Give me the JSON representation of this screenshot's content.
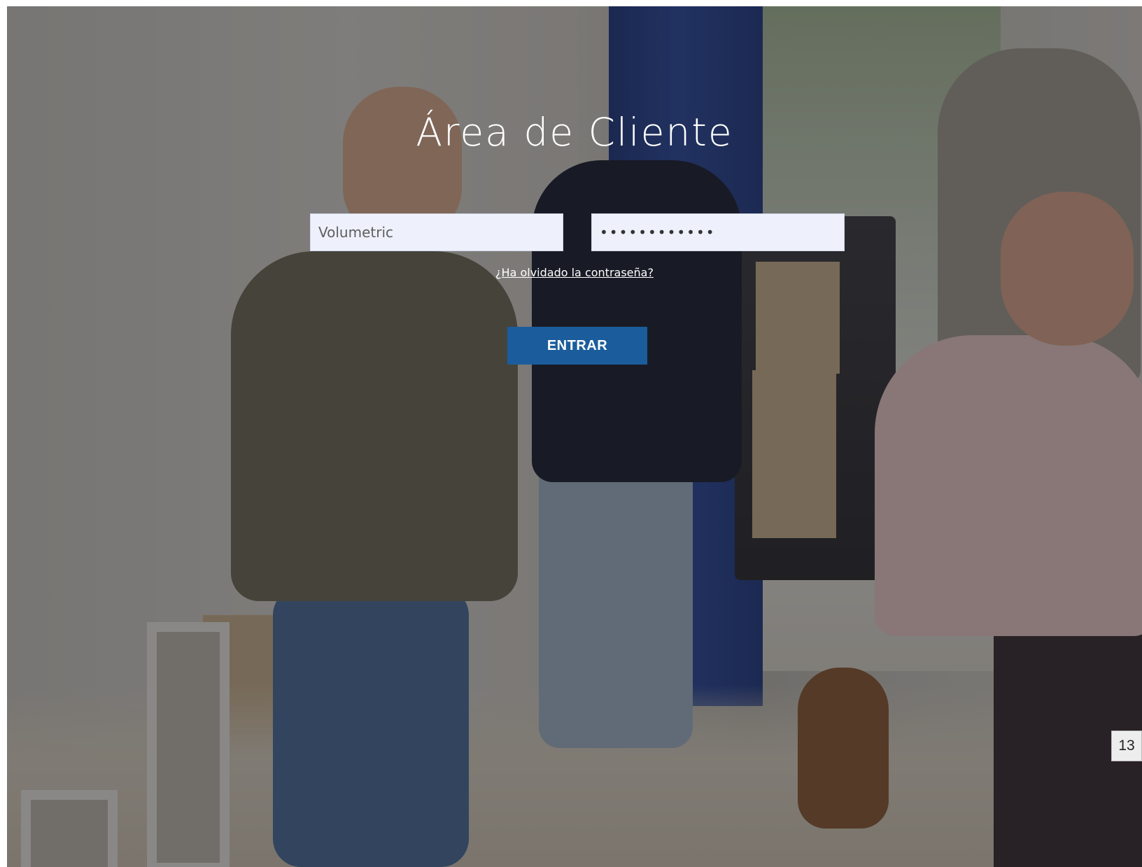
{
  "login": {
    "title": "Área de Cliente",
    "username_value": "Volumetric",
    "password_value": "••••••••••••",
    "forgot_link": "¿Ha olvidado la contraseña?",
    "submit_label": "ENTRAR"
  },
  "page_badge": "13",
  "colors": {
    "button": "#1b5d9c",
    "input_background": "#eef1fb"
  }
}
